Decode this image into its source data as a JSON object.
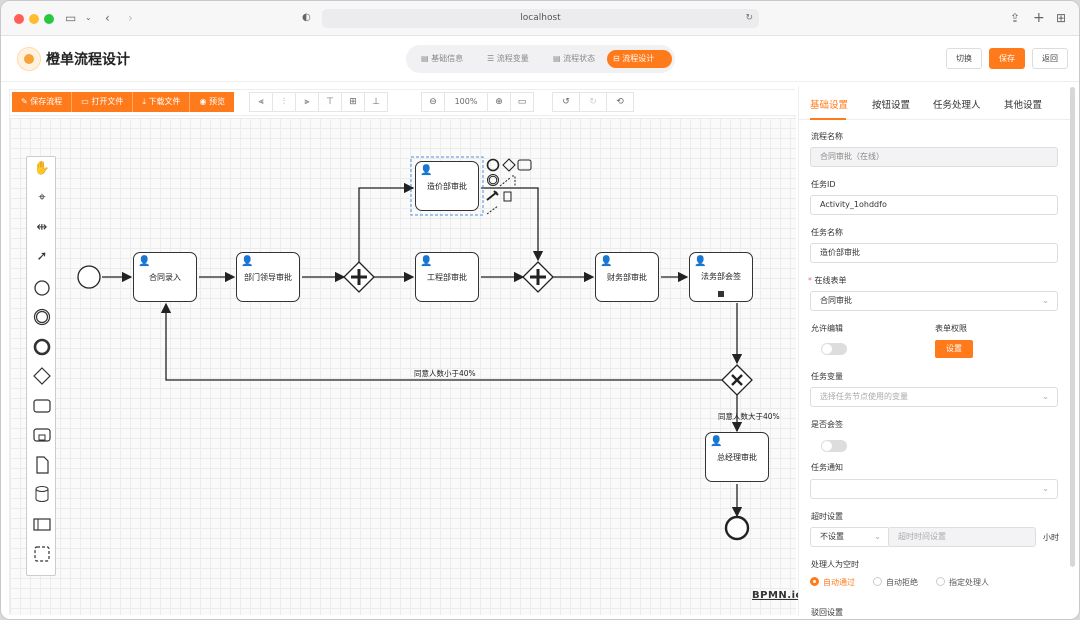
{
  "browser": {
    "url": "localhost"
  },
  "app": {
    "title": "橙单流程设计"
  },
  "steps": [
    {
      "label": "基础信息",
      "icon": "doc-icon"
    },
    {
      "label": "流程变量",
      "icon": "list-icon"
    },
    {
      "label": "流程状态",
      "icon": "doc-icon"
    },
    {
      "label": "流程设计",
      "icon": "design-icon"
    }
  ],
  "header_buttons": {
    "switch": "切换",
    "save": "保存",
    "back": "返回"
  },
  "toolbar": {
    "save_flow": "保存流程",
    "open_file": "打开文件",
    "download_file": "下载文件",
    "preview": "预览",
    "zoom": "100%"
  },
  "diagram": {
    "tasks": {
      "contract_entry": "合同录入",
      "dept_leader": "部门领导审批",
      "cost_dept": "造价部审批",
      "engineering": "工程部审批",
      "finance": "财务部审批",
      "legal": "法务部会签",
      "gm": "总经理审批"
    },
    "flows": {
      "less_than": "同意人数小于40%",
      "greater_than": "同意人数大于40%"
    },
    "watermark": "BPMN.io"
  },
  "panel": {
    "tabs": [
      "基础设置",
      "按钮设置",
      "任务处理人",
      "其他设置"
    ],
    "flow_name": {
      "label": "流程名称",
      "value": "合同审批（在线）"
    },
    "task_id": {
      "label": "任务ID",
      "value": "Activity_1ohddfo"
    },
    "task_name": {
      "label": "任务名称",
      "value": "造价部审批"
    },
    "online_form": {
      "required": "*",
      "label": "在线表单",
      "value": "合同审批"
    },
    "allow_edit": {
      "label": "允许编辑"
    },
    "form_permission": {
      "label": "表单权限",
      "button": "设置"
    },
    "task_variables": {
      "label": "任务变量",
      "placeholder": "选择任务节点使用的变量"
    },
    "countersign": {
      "label": "是否会签"
    },
    "task_notice": {
      "label": "任务通知"
    },
    "timeout": {
      "label": "超时设置",
      "select": "不设置",
      "placeholder": "超时时间设置",
      "unit": "小时"
    },
    "empty_handler": {
      "label": "处理人为空时",
      "options": [
        "自动通过",
        "自动拒绝",
        "指定处理人"
      ],
      "selected": "自动通过"
    },
    "reject": {
      "label": "驳回设置"
    }
  },
  "colors": {
    "accent": "#ff7a1a"
  }
}
